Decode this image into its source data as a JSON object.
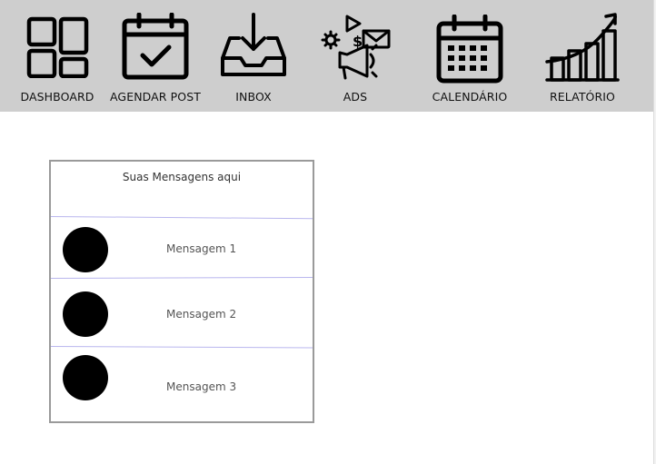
{
  "nav": {
    "items": [
      {
        "id": "dashboard",
        "label": "DASHBOARD",
        "icon": "dashboard-grid-icon"
      },
      {
        "id": "agendar",
        "label": "AGENDAR POST",
        "icon": "calendar-check-icon"
      },
      {
        "id": "inbox",
        "label": "INBOX",
        "icon": "inbox-tray-icon"
      },
      {
        "id": "ads",
        "label": "ADS",
        "icon": "megaphone-ads-icon"
      },
      {
        "id": "calendario",
        "label": "CALENDÁRIO",
        "icon": "calendar-grid-icon"
      },
      {
        "id": "relatorio",
        "label": "RELATÓRIO",
        "icon": "growth-chart-icon"
      }
    ]
  },
  "inbox": {
    "title": "Suas Mensagens aqui",
    "messages": [
      {
        "text": "Mensagem 1"
      },
      {
        "text": "Mensagem 2"
      },
      {
        "text": "Mensagem 3"
      }
    ]
  },
  "colors": {
    "topbar": "#cecece",
    "separator": "#b9b6ee",
    "panel_border": "#9a9a9a"
  }
}
